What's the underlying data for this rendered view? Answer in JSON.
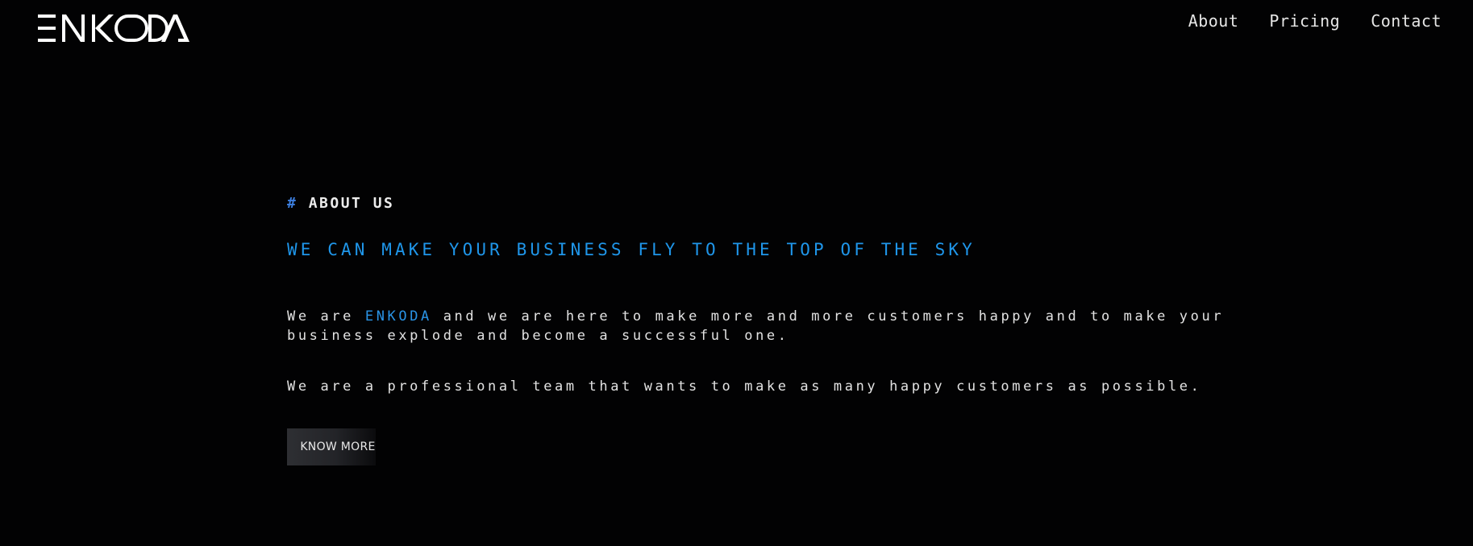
{
  "header": {
    "logo_text": "ENKODA",
    "nav": [
      {
        "label": "About"
      },
      {
        "label": "Pricing"
      },
      {
        "label": "Contact"
      }
    ]
  },
  "about": {
    "eyebrow_hash": "#",
    "eyebrow": "ABOUT US",
    "headline": "WE CAN MAKE YOUR BUSINESS FLY TO THE TOP OF THE SKY",
    "paragraph1": {
      "prefix": "We are ",
      "brand": "ENKODA",
      "suffix": " and we are here to make more and more customers happy and to make your business explode and become a successful one."
    },
    "paragraph2": "We are a professional team that wants to make as many happy customers as possible.",
    "button_label": "KNOW MORE"
  },
  "colors": {
    "background": "#020203",
    "accent_blue": "#1f96ea",
    "hash_blue": "#3d7fe0",
    "text": "#e2e2e2"
  }
}
